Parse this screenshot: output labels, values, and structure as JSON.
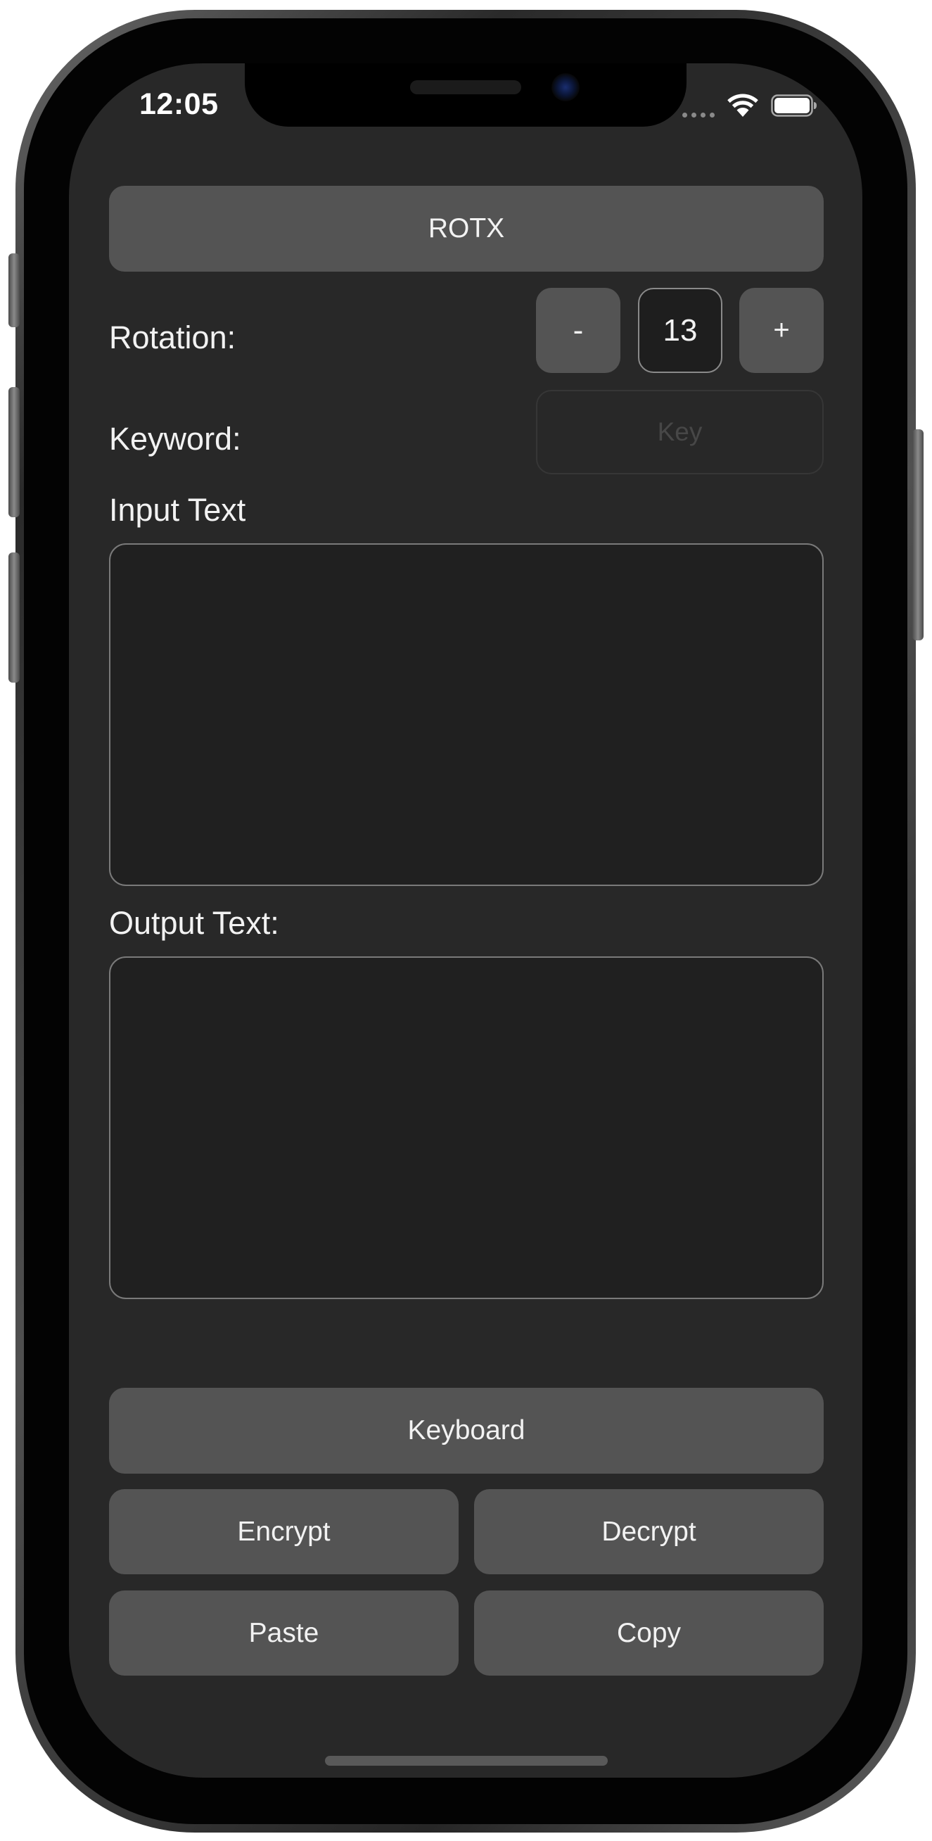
{
  "status_bar": {
    "time": "12:05",
    "wifi_icon": "wifi-icon",
    "battery_icon": "battery-icon"
  },
  "app": {
    "cipher_button_label": "ROTX",
    "rotation": {
      "label": "Rotation:",
      "decrement_label": "-",
      "value": "13",
      "increment_label": "+"
    },
    "keyword": {
      "label": "Keyword:",
      "placeholder": "Key",
      "value": ""
    },
    "input": {
      "label": "Input Text",
      "value": ""
    },
    "output": {
      "label": "Output Text:",
      "value": ""
    },
    "actions": {
      "keyboard_label": "Keyboard",
      "encrypt_label": "Encrypt",
      "decrypt_label": "Decrypt",
      "paste_label": "Paste",
      "copy_label": "Copy"
    }
  },
  "theme": {
    "background": "#282828",
    "button": "#545454",
    "text": "#f2f2f2",
    "field_background": "#202020",
    "field_border": "#7a7a7a"
  }
}
